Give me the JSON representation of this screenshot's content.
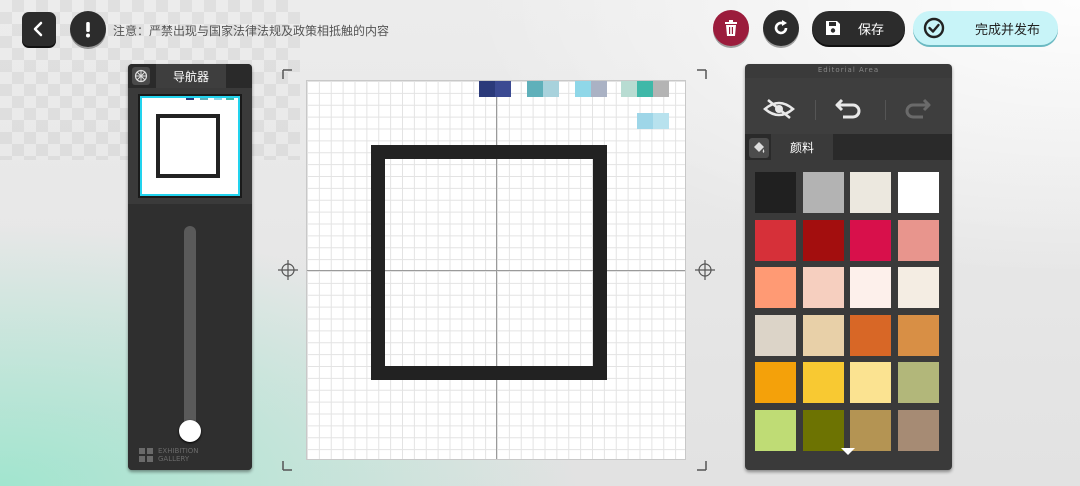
{
  "topbar": {
    "back_icon": "chevron-left-icon",
    "info_icon": "exclamation-icon",
    "notice_text": "注意：严禁出现与国家法律法规及政策相抵触的内容",
    "delete_icon": "trash-icon",
    "reset_icon": "rotate-icon",
    "save_label": "保存",
    "publish_label": "完成并发布",
    "delete_color": "#9b1c3c",
    "publish_color": "#c8f4f8"
  },
  "navigator": {
    "tab_label": "导航器",
    "brand_line1": "EXHIBITION",
    "brand_line2": "GALLERY"
  },
  "editor": {
    "area_title": "Editorial Area",
    "tools": [
      "eye-off-icon",
      "undo-icon",
      "redo-icon"
    ],
    "palette_tab_label": "颜料"
  },
  "palette": {
    "colors": [
      "#202020",
      "#b3b3b3",
      "#ece8df",
      "#ffffff",
      "#d63039",
      "#a30e0e",
      "#d8104b",
      "#e8958d",
      "#ff9a74",
      "#f6cfbf",
      "#fdf0eb",
      "#f4ede3",
      "#dcd4c8",
      "#e8d0a8",
      "#d86726",
      "#d88f45",
      "#f4a10a",
      "#f8c932",
      "#fbe391",
      "#b2b77a",
      "#bfdc75",
      "#6d7302",
      "#b49453",
      "#a68b74"
    ]
  }
}
